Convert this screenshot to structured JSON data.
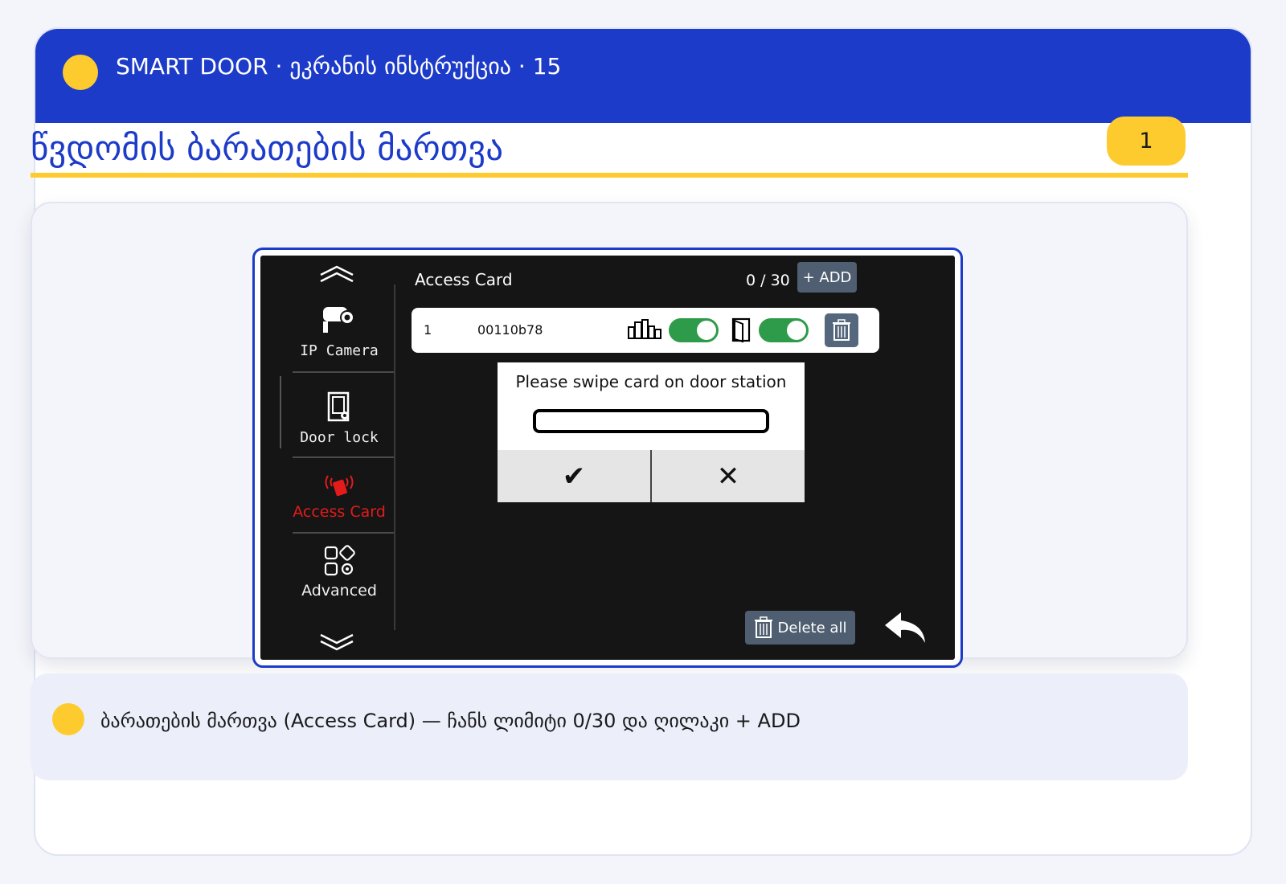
{
  "header": {
    "title": "SMART DOOR · ეკრანის ინსტრუქცია · 15"
  },
  "page": {
    "title": "წვდომის ბარათების მართვა",
    "badge": "1"
  },
  "device": {
    "sidebar": {
      "items": [
        {
          "label": "IP Camera",
          "icon": "ip-camera-icon"
        },
        {
          "label": "Door lock",
          "icon": "door-lock-icon"
        },
        {
          "label": "Access Card",
          "icon": "access-card-icon",
          "active": true
        },
        {
          "label": "Advanced",
          "icon": "advanced-icon"
        }
      ]
    },
    "title": "Access Card",
    "count": "0 / 30",
    "add_label": "+ ADD",
    "cards": [
      {
        "index": "1",
        "code": "00110b78",
        "building_toggle": true,
        "door_toggle": true
      }
    ],
    "dialog": {
      "message": "Please swipe card on door station",
      "input_value": "",
      "confirm": "✔",
      "cancel": "✕"
    },
    "delete_all_label": "Delete all"
  },
  "note": {
    "text": "ბარათების მართვა (Access Card) — ჩანს ლიმიტი 0/30 და ღილაკი + ADD"
  },
  "colors": {
    "header": "#1c3bc9",
    "accent": "#fecb2e",
    "active": "#e31b1b",
    "toggle_on": "#2e9b4a"
  }
}
